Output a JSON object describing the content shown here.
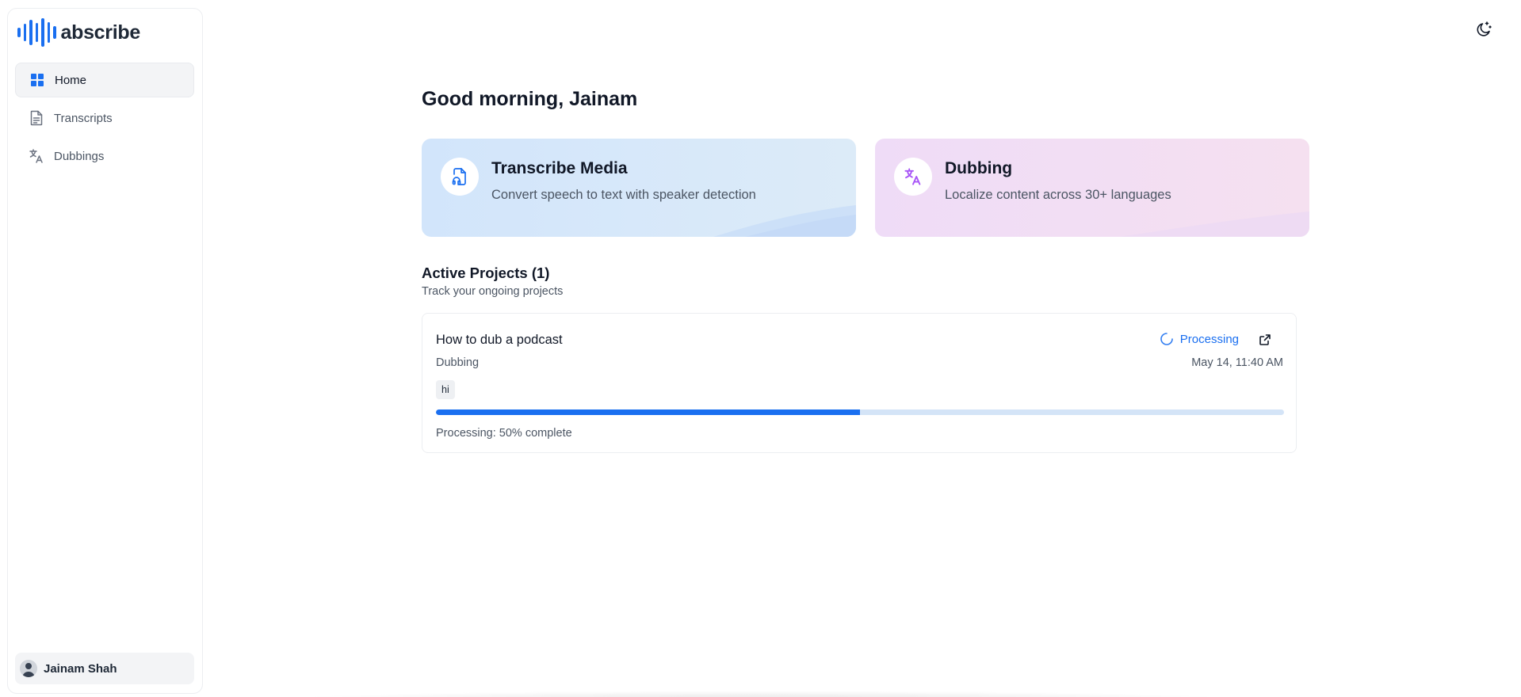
{
  "app": {
    "name": "abscribe"
  },
  "sidebar": {
    "items": [
      {
        "label": "Home",
        "icon": "grid-icon",
        "active": true
      },
      {
        "label": "Transcripts",
        "icon": "document-icon",
        "active": false
      },
      {
        "label": "Dubbings",
        "icon": "translate-icon",
        "active": false
      }
    ],
    "user": {
      "name": "Jainam Shah"
    }
  },
  "header": {
    "theme_toggle_icon": "moon-icon"
  },
  "main": {
    "greeting": "Good morning, Jainam",
    "cards": [
      {
        "title": "Transcribe Media",
        "description": "Convert speech to text with speaker detection",
        "icon": "file-audio-icon",
        "accent": "#1a6ff0"
      },
      {
        "title": "Dubbing",
        "description": "Localize content across 30+ languages",
        "icon": "translate-icon",
        "accent": "#a855f7"
      }
    ],
    "active_projects": {
      "title": "Active Projects (1)",
      "subtitle": "Track your ongoing projects",
      "projects": [
        {
          "title": "How to dub a podcast",
          "type": "Dubbing",
          "status": "Processing",
          "date": "May 14, 11:40 AM",
          "language": "hi",
          "progress": 0.5,
          "progress_text": "Processing: 50% complete"
        }
      ]
    }
  },
  "colors": {
    "accent": "#1a6ff0",
    "progress_track": "#d4e4f7"
  }
}
